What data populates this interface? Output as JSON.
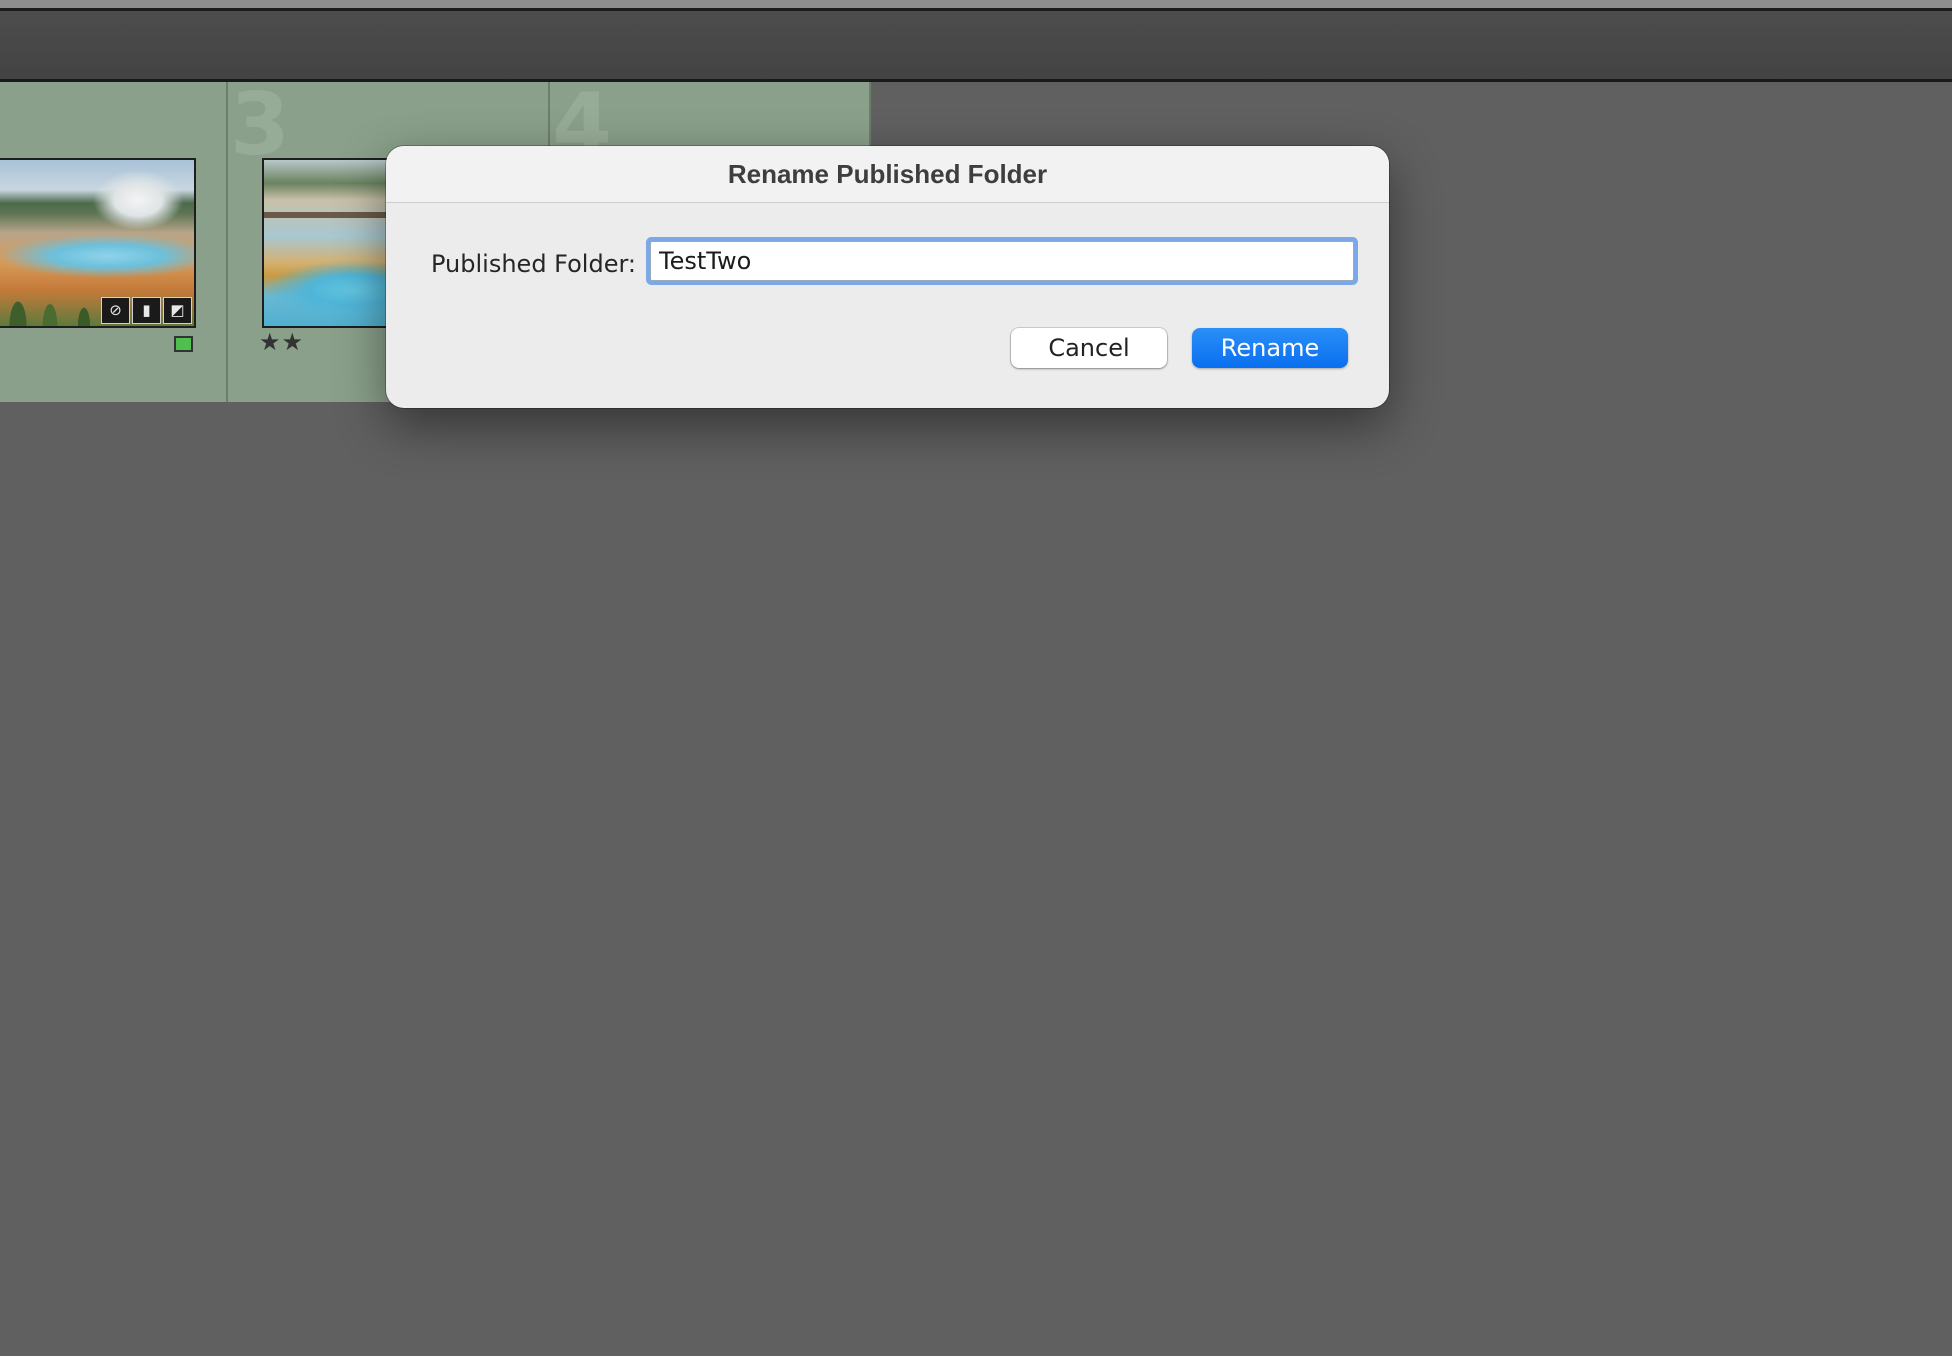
{
  "grid": {
    "cells": [
      {
        "number": ""
      },
      {
        "number": "3"
      },
      {
        "number": "4"
      }
    ],
    "thumb_icons": [
      "tag-icon",
      "comment-icon",
      "adjust-icon"
    ],
    "rating": "★★",
    "color_label": "#4fbf4f"
  },
  "dialog": {
    "title": "Rename Published Folder",
    "field_label": "Published Folder:",
    "field_value": "TestTwo",
    "cancel_label": "Cancel",
    "rename_label": "Rename"
  },
  "colors": {
    "background": "#606060",
    "cell_background": "#8aa08a",
    "accent_blue": "#0a6ff0",
    "focus_ring": "#7ba8e8"
  }
}
